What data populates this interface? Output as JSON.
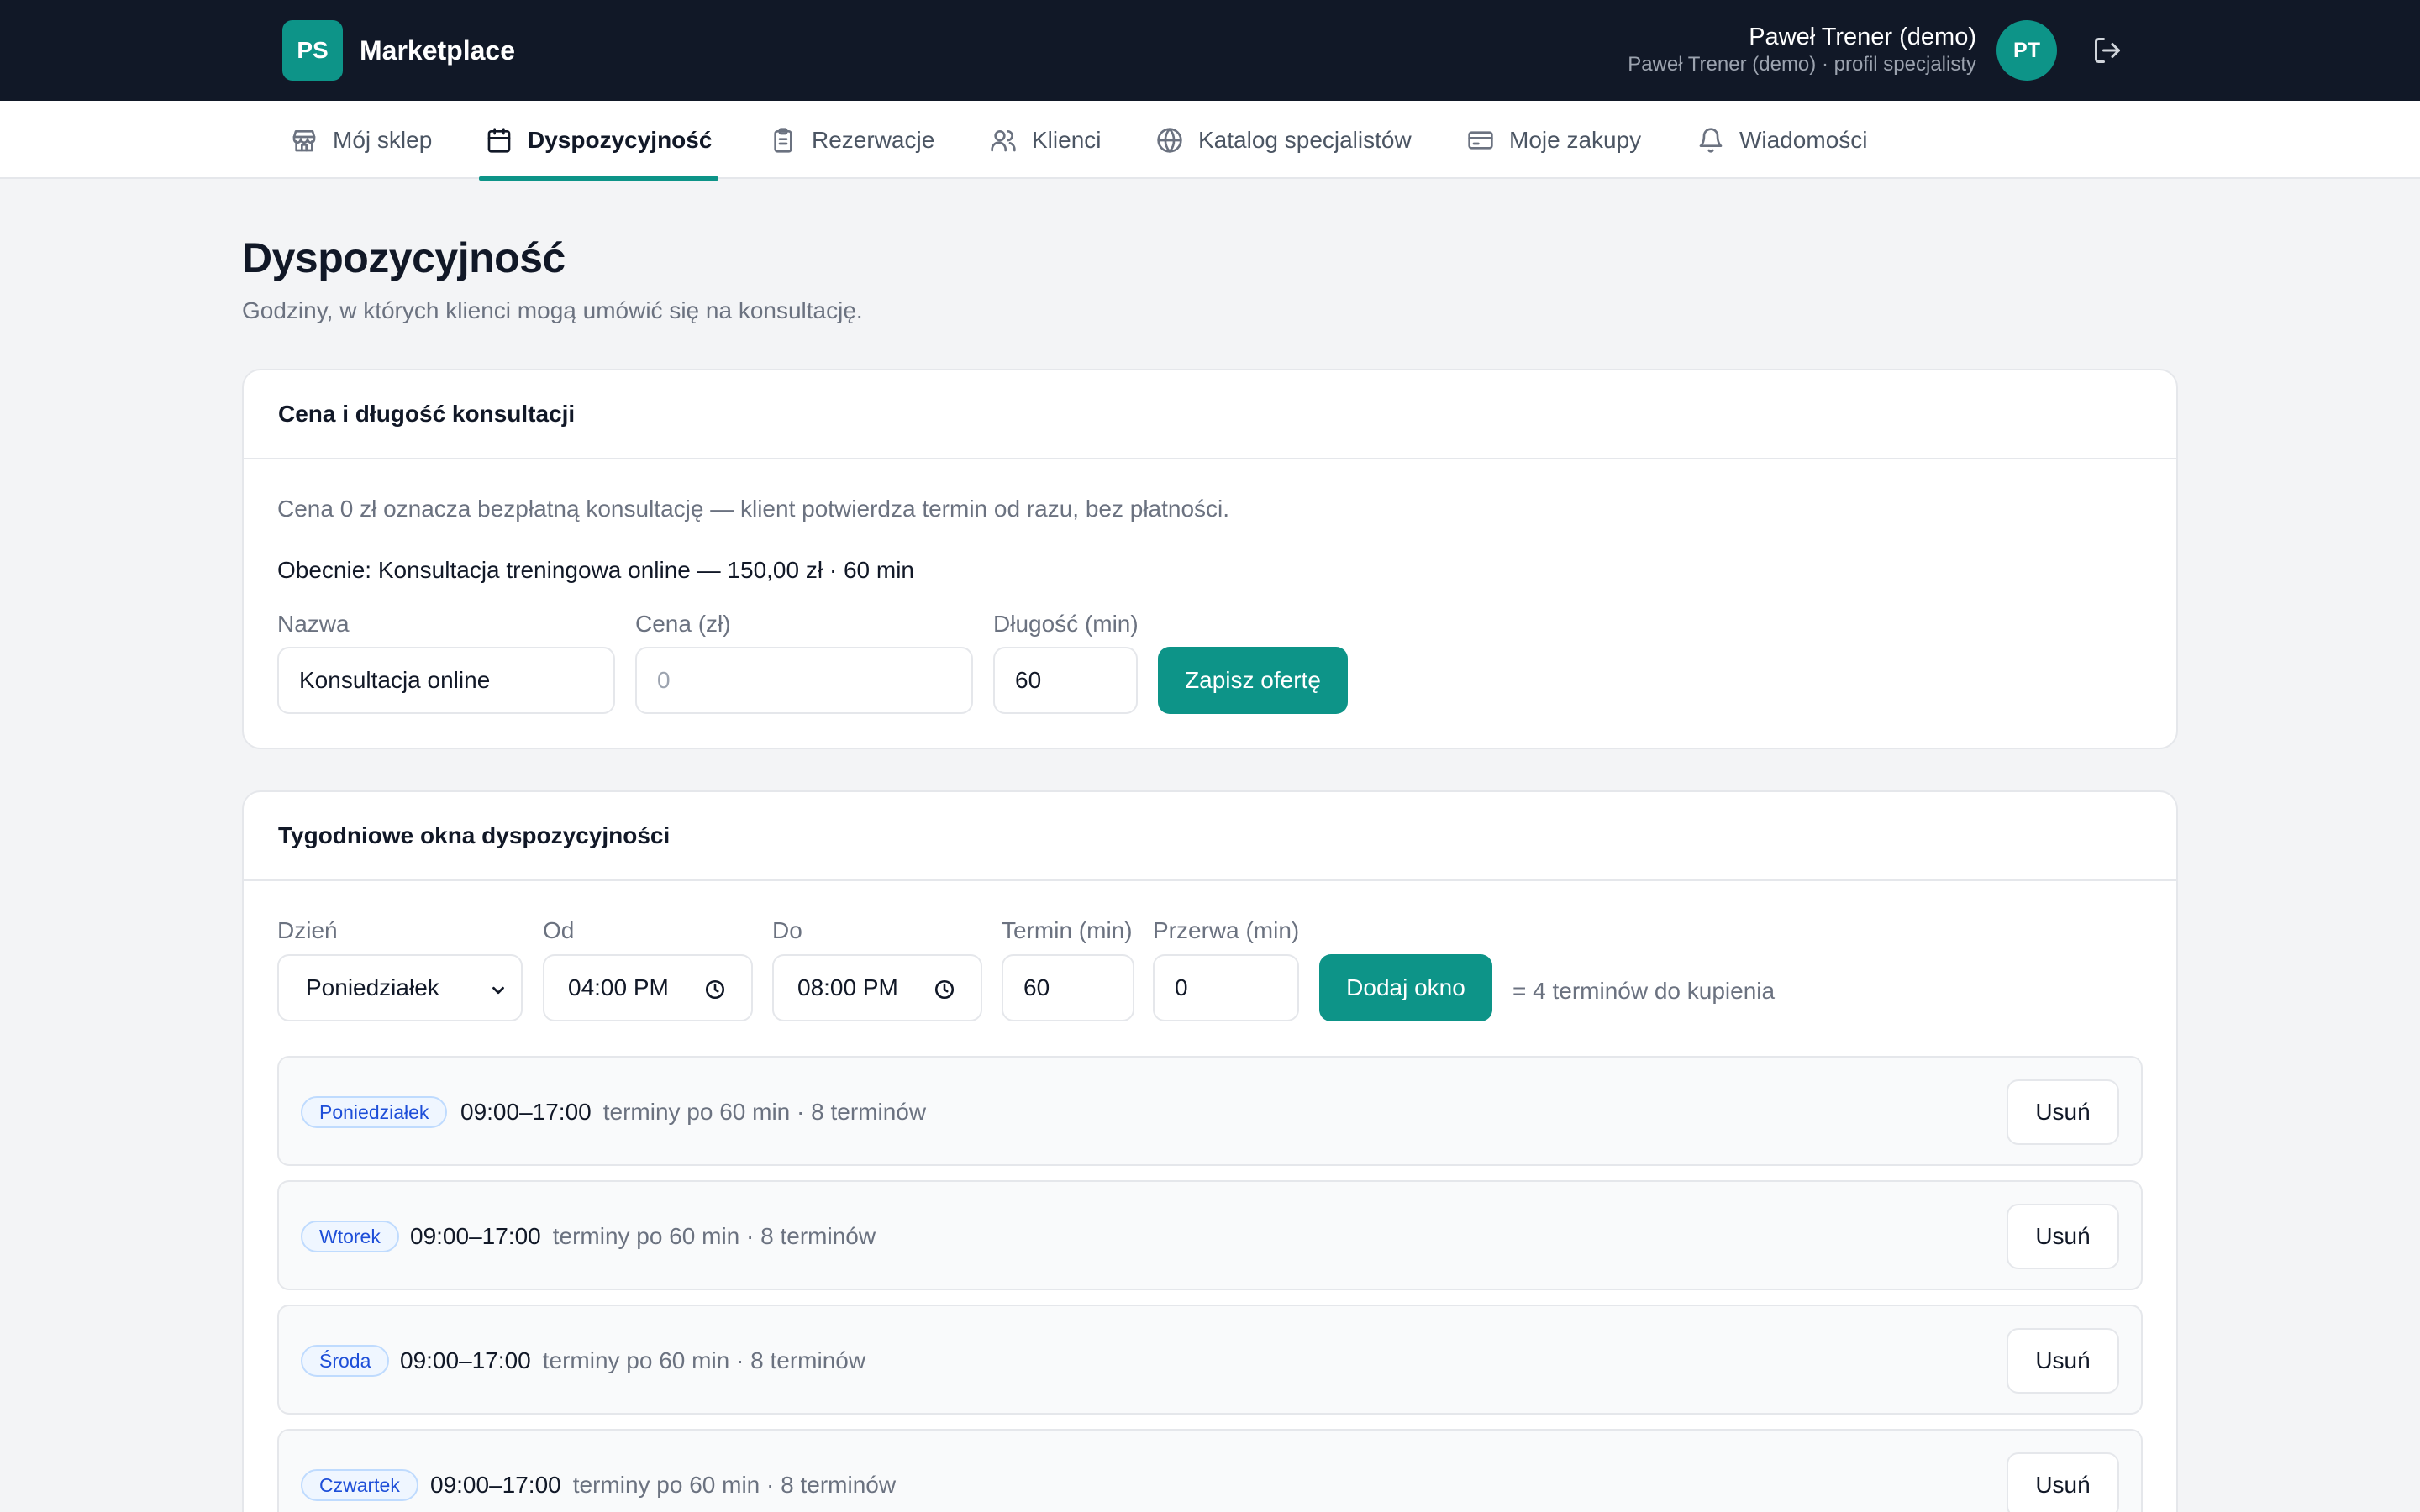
{
  "header": {
    "logo_text": "PS",
    "brand": "Marketplace",
    "user_name": "Paweł Trener (demo)",
    "user_sub": "Paweł Trener (demo) · profil specjalisty",
    "avatar_initials": "PT"
  },
  "nav": {
    "items": [
      {
        "label": "Mój sklep",
        "icon": "store-icon"
      },
      {
        "label": "Dyspozycyjność",
        "icon": "calendar-icon",
        "active": true
      },
      {
        "label": "Rezerwacje",
        "icon": "clipboard-icon"
      },
      {
        "label": "Klienci",
        "icon": "users-icon"
      },
      {
        "label": "Katalog specjalistów",
        "icon": "globe-icon"
      },
      {
        "label": "Moje zakupy",
        "icon": "credit-card-icon"
      },
      {
        "label": "Wiadomości",
        "icon": "bell-icon"
      }
    ]
  },
  "page": {
    "title": "Dyspozycyjność",
    "subtitle": "Godziny, w których klienci mogą umówić się na konsultację."
  },
  "offer": {
    "title": "Cena i długość konsultacji",
    "note": "Cena 0 zł oznacza bezpłatną konsultację — klient potwierdza termin od razu, bez płatności.",
    "current": "Obecnie: Konsultacja treningowa online — 150,00 zł · 60 min",
    "name_label": "Nazwa",
    "name_value": "Konsultacja online",
    "price_label": "Cena (zł)",
    "price_placeholder": "0",
    "duration_label": "Długość (min)",
    "duration_value": "60",
    "save_label": "Zapisz ofertę"
  },
  "windows": {
    "title": "Tygodniowe okna dyspozycyjności",
    "day_label": "Dzień",
    "day_value": "Poniedziałek",
    "from_label": "Od",
    "from_value": "04:00 PM",
    "to_label": "Do",
    "to_value": "08:00 PM",
    "slot_label": "Termin (min)",
    "slot_value": "60",
    "break_label": "Przerwa (min)",
    "break_value": "0",
    "add_label": "Dodaj okno",
    "summary": "= 4 terminów do kupienia",
    "rows": [
      {
        "day": "Poniedziałek",
        "time": "09:00–17:00",
        "info": "terminy po 60 min · 8 terminów",
        "remove": "Usuń"
      },
      {
        "day": "Wtorek",
        "time": "09:00–17:00",
        "info": "terminy po 60 min · 8 terminów",
        "remove": "Usuń"
      },
      {
        "day": "Środa",
        "time": "09:00–17:00",
        "info": "terminy po 60 min · 8 terminów",
        "remove": "Usuń"
      },
      {
        "day": "Czwartek",
        "time": "09:00–17:00",
        "info": "terminy po 60 min · 8 terminów",
        "remove": "Usuń"
      }
    ]
  },
  "colors": {
    "accent": "#0d9488",
    "header_bg": "#111827",
    "badge_text": "#1d4ed8"
  }
}
